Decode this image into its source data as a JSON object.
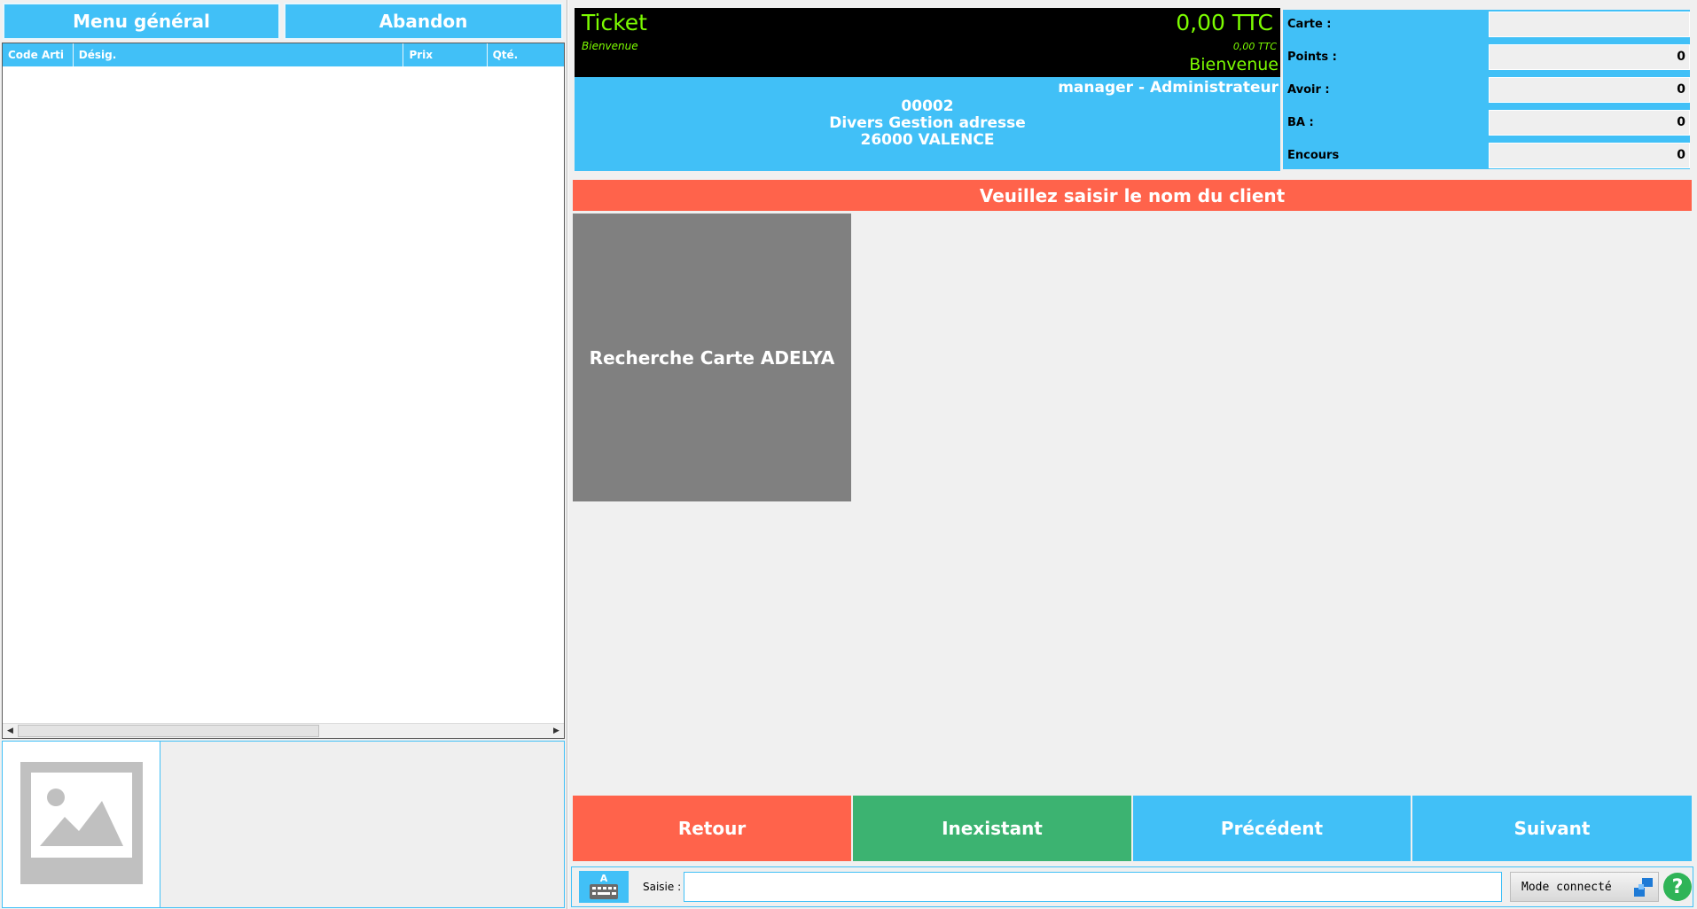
{
  "top_buttons": {
    "menu": "Menu général",
    "abandon": "Abandon"
  },
  "grid": {
    "columns": [
      "Code Arti",
      "Désig.",
      "Prix",
      "Qté."
    ]
  },
  "ticket": {
    "title": "Ticket",
    "total": "0,00 TTC",
    "subtitle": "Bienvenue",
    "total_small": "0,00 TTC",
    "welcome": "Bienvenue"
  },
  "customer": {
    "user": "manager - Administrateur",
    "code": "00002",
    "name": "Divers Gestion adresse",
    "city": "26000 VALENCE"
  },
  "loyalty": {
    "fields": [
      {
        "label": "Carte :",
        "value": ""
      },
      {
        "label": "Points :",
        "value": "0"
      },
      {
        "label": "Avoir :",
        "value": "0"
      },
      {
        "label": "BA :",
        "value": "0"
      },
      {
        "label": "Encours",
        "value": "0"
      }
    ]
  },
  "prompt": "Veuillez saisir le nom du client",
  "search_card_label": "Recherche Carte ADELYA",
  "actions": {
    "retour": "Retour",
    "inexistant": "Inexistant",
    "precedent": "Précédent",
    "suivant": "Suivant"
  },
  "input_bar": {
    "label": "Saisie :",
    "value": "",
    "mode": "Mode connecté",
    "help": "?"
  },
  "icons": {
    "keyboard": "keyboard-icon",
    "image_placeholder": "image-placeholder-icon",
    "connection": "network-icon",
    "help": "help-icon"
  },
  "colors": {
    "blue": "#41c0f7",
    "red": "#ff634b",
    "green": "#3cb371",
    "ticket_text": "#7cfc00",
    "grey_card": "#808080"
  }
}
